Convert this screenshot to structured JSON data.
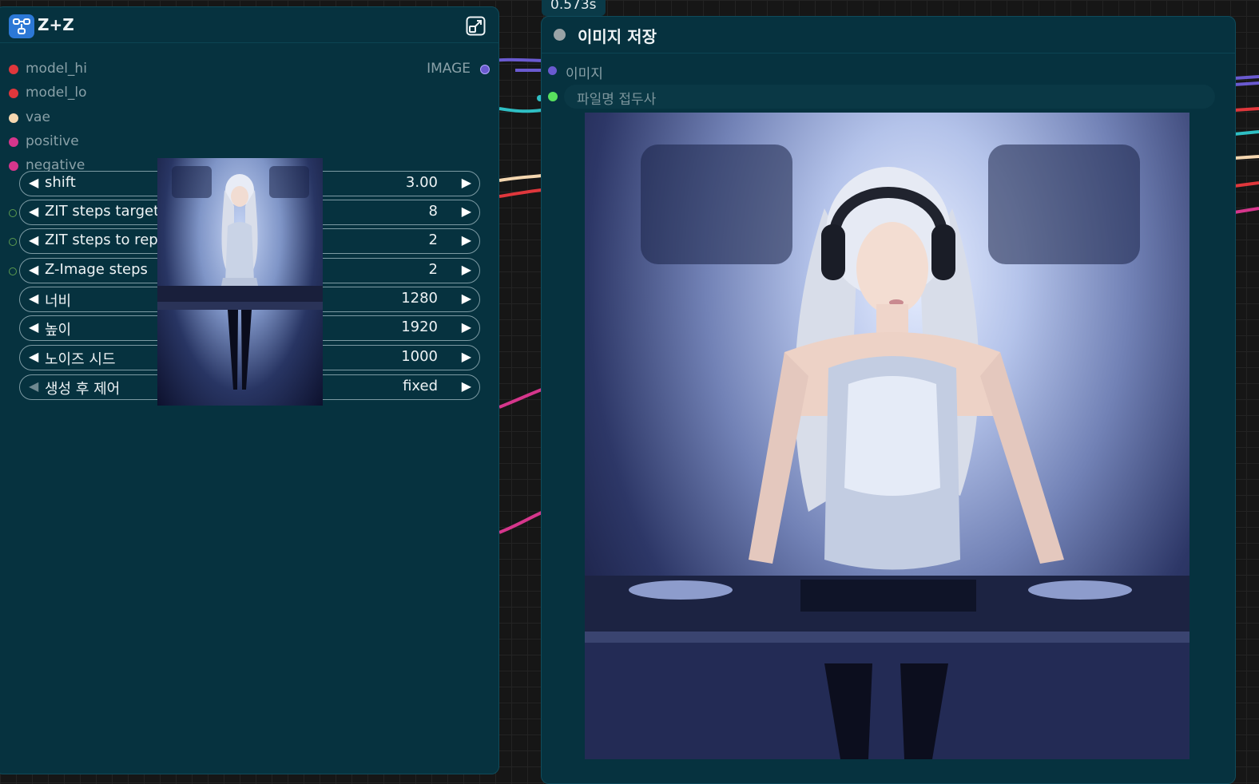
{
  "left_node": {
    "title": "Z+Z",
    "inputs": [
      {
        "label": "model_hi",
        "color": "#e0373c"
      },
      {
        "label": "model_lo",
        "color": "#e0373c"
      },
      {
        "label": "vae",
        "color": "#f5d7b0"
      },
      {
        "label": "positive",
        "color": "#d6368c"
      },
      {
        "label": "negative",
        "color": "#d6368c"
      }
    ],
    "output": {
      "label": "IMAGE",
      "color": "#6a5ad0"
    },
    "widgets": [
      {
        "label": "shift",
        "value": "3.00"
      },
      {
        "label": "ZIT steps target",
        "value": "8"
      },
      {
        "label": "ZIT steps to repl",
        "value": "2"
      },
      {
        "label": "Z-Image steps",
        "value": "2"
      },
      {
        "label": "너비",
        "value": "1280"
      },
      {
        "label": "높이",
        "value": "1920"
      },
      {
        "label": "노이즈 시드",
        "value": "1000"
      },
      {
        "label": "생성 후 제어",
        "value": "fixed"
      }
    ]
  },
  "right_node": {
    "execution_time": "0.573s",
    "title": "이미지 저장",
    "input_label": "이미지",
    "filename_prefix_placeholder": "파일명 접두사"
  },
  "icons": {
    "subgraph": "subgraph-icon",
    "expand": "expand-icon",
    "decrement": "arrow-left-icon",
    "increment": "arrow-right-icon"
  }
}
